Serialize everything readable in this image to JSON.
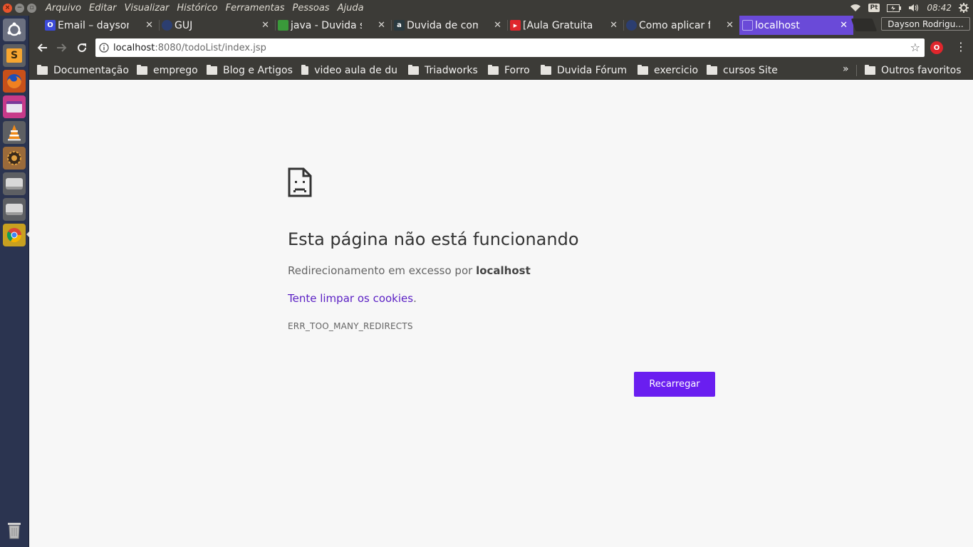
{
  "system": {
    "menu": [
      "Arquivo",
      "Editar",
      "Visualizar",
      "Histórico",
      "Ferramentas",
      "Pessoas",
      "Ajuda"
    ],
    "keyboard_layout": "Pt",
    "clock": "08:42"
  },
  "launcher": {
    "icons": [
      "ubuntu-dash-icon",
      "sublime-text-icon",
      "firefox-icon",
      "software-center-icon",
      "vlc-icon",
      "app-settings-icon",
      "drive-icon",
      "drive-icon",
      "chrome-icon",
      "trash-icon"
    ],
    "sublime_letter": "S"
  },
  "tabs": [
    {
      "title": "Email – dayson",
      "favicon": "outlook-icon",
      "fav_text": "O",
      "fav_color": "#3b4ad8"
    },
    {
      "title": "GUJ",
      "favicon": "guj-icon",
      "fav_text": "",
      "fav_color": "#2c3e70"
    },
    {
      "title": "java - Duvida so",
      "favicon": "stackoverflow-icon",
      "fav_text": "",
      "fav_color": "#3a9a3a"
    },
    {
      "title": "Duvida de com",
      "favicon": "alura-icon",
      "fav_text": "a",
      "fav_color": "#2a3a40"
    },
    {
      "title": "[Aula Gratuita",
      "favicon": "youtube-icon",
      "fav_text": "▶",
      "fav_color": "#e0262c"
    },
    {
      "title": "Como aplicar fi",
      "favicon": "guj-icon",
      "fav_text": "",
      "fav_color": "#2c3e70"
    },
    {
      "title": "localhost",
      "favicon": "page-icon",
      "fav_text": "",
      "fav_color": "#8a7ae0",
      "active": true
    }
  ],
  "profile": {
    "name": "Dayson Rodrigu..."
  },
  "omnibox": {
    "host": "localhost",
    "path": ":8080/todoList/index.jsp"
  },
  "extension": {
    "label": "O"
  },
  "bookmarks": [
    "Documentação",
    "emprego",
    "Blog e Artigos",
    "video aula de du",
    "Triadworks",
    "Forro",
    "Duvida Fórum",
    "exercicio",
    "cursos Site"
  ],
  "bookmarks_more": "»",
  "other_bookmarks": "Outros favoritos",
  "error": {
    "title": "Esta página não está funcionando",
    "desc_prefix": "Redirecionamento em excesso por ",
    "desc_host": "localhost",
    "link": "Tente limpar os cookies",
    "link_suffix": ".",
    "code": "ERR_TOO_MANY_REDIRECTS",
    "reload_label": "Recarregar"
  },
  "colors": {
    "accent": "#6a1ef0",
    "tab_active": "#6a4ad8",
    "link": "#5a1fc4"
  }
}
